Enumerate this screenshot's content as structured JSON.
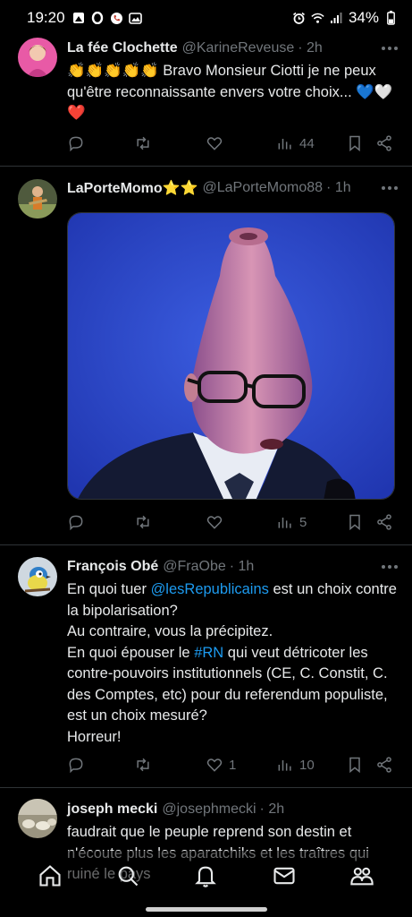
{
  "status_bar": {
    "time": "19:20",
    "battery": "34%",
    "icons": [
      "gallery-notification-icon",
      "opera-icon",
      "phone-icon",
      "image-icon",
      "alarm-icon",
      "wifi-icon",
      "signal-icon",
      "battery-icon"
    ]
  },
  "tweets": [
    {
      "display_name": "La fée Clochette",
      "handle": "@KarineReveuse",
      "time": "· 2h",
      "text": "👏👏👏👏👏 Bravo Monsieur Ciotti je ne peux qu'être reconnaissante envers votre choix... 💙🤍❤️",
      "replies": "",
      "retweets": "",
      "likes": "",
      "views": "44"
    },
    {
      "display_name": "LaPorteMomo⭐⭐",
      "handle": "@LaPorteMomo88",
      "time": "· 1h",
      "media": "photo-edited-portrait",
      "replies": "",
      "retweets": "",
      "likes": "",
      "views": "5"
    },
    {
      "display_name": "François Obé",
      "handle": "@FraObe",
      "time": "· 1h",
      "text_parts": {
        "p1": "En quoi tuer ",
        "mention": "@lesRepublicains",
        "p2": " est un choix contre la bipolarisation?",
        "line2": "Au contraire, vous la précipitez.",
        "p3": "En quoi épouser le ",
        "hashtag": "#RN",
        "p4": " qui veut détricoter les contre-pouvoirs institutionnels (CE, C. Constit, C. des Comptes, etc) pour du referendum populiste, est un choix mesuré?",
        "line4": "Horreur!"
      },
      "replies": "",
      "retweets": "",
      "likes": "1",
      "views": "10"
    },
    {
      "display_name": "joseph mecki",
      "handle": "@josephmecki",
      "time": "· 2h",
      "text": "faudrait que le peuple reprend son destin et n'écoute plus les aparatchiks et les traîtres qui ruiné le pays"
    }
  ],
  "colors": {
    "background": "#000000",
    "text": "#e7e9ea",
    "secondary": "#71767b",
    "link": "#1d9bf0",
    "divider": "#2f3336",
    "media_background": "#2b48c8"
  },
  "bottom_nav": [
    "home-icon",
    "search-icon",
    "notifications-icon",
    "messages-icon",
    "communities-icon"
  ]
}
